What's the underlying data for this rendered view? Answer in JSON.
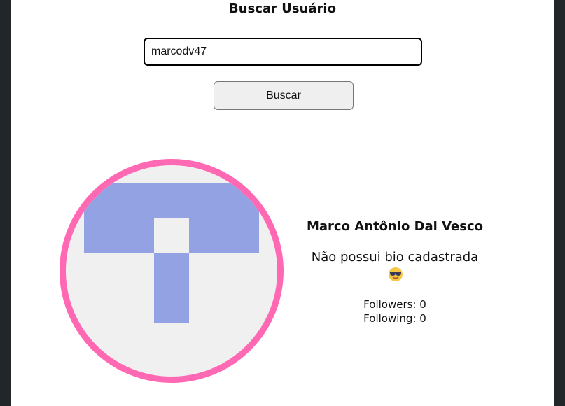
{
  "search": {
    "title": "Buscar Usuário",
    "input_value": "marcodv47",
    "button_label": "Buscar"
  },
  "profile": {
    "name": "Marco Antônio Dal Vesco",
    "bio": "Não possui bio cadastrada",
    "bio_icon": "sunglasses-face-icon",
    "followers_label": "Followers:",
    "followers_count": "0",
    "following_label": "Following:",
    "following_count": "0"
  },
  "colors": {
    "avatar_border": "#ff69b4",
    "avatar_background": "#f0f0f0",
    "identicon": "#92a2e3"
  }
}
